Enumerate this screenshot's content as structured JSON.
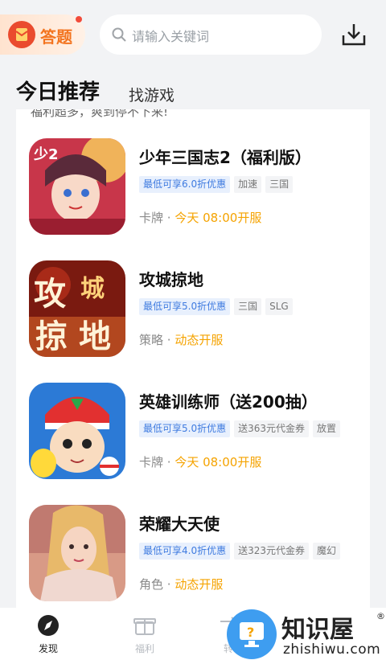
{
  "header": {
    "quiz_label": "答题",
    "search_placeholder": "请输入关键词"
  },
  "tabs": [
    {
      "label": "今日推荐"
    },
    {
      "label": "找游戏"
    }
  ],
  "list_intro": "福利超多，爽到停不下来!",
  "games": [
    {
      "title": "少年三国志2（福利版）",
      "tags": [
        "最低可享6.0折优惠",
        "加速",
        "三国"
      ],
      "genre": "卡牌",
      "open": "今天 08:00开服"
    },
    {
      "title": "攻城掠地",
      "tags": [
        "最低可享5.0折优惠",
        "三国",
        "SLG"
      ],
      "genre": "策略",
      "open": "动态开服"
    },
    {
      "title": "英雄训练师（送200抽）",
      "tags": [
        "最低可享5.0折优惠",
        "送363元代金券",
        "放置"
      ],
      "genre": "卡牌",
      "open": "今天 08:00开服"
    },
    {
      "title": "荣耀大天使",
      "tags": [
        "最低可享4.0折优惠",
        "送323元代金券",
        "魔幻"
      ],
      "genre": "角色",
      "open": "动态开服"
    }
  ],
  "bottom_nav": [
    {
      "label": "发现",
      "icon": "compass-icon"
    },
    {
      "label": "福利",
      "icon": "gift-box-icon"
    },
    {
      "label": "转",
      "icon": "transfer-icon"
    }
  ],
  "watermark": {
    "brand": "知识屋",
    "url": "zhishiwu.com",
    "reg": "®"
  },
  "colors": {
    "accent": "#f5a300",
    "discount_tag": "#3f7be0",
    "quiz": "#f3741f"
  }
}
